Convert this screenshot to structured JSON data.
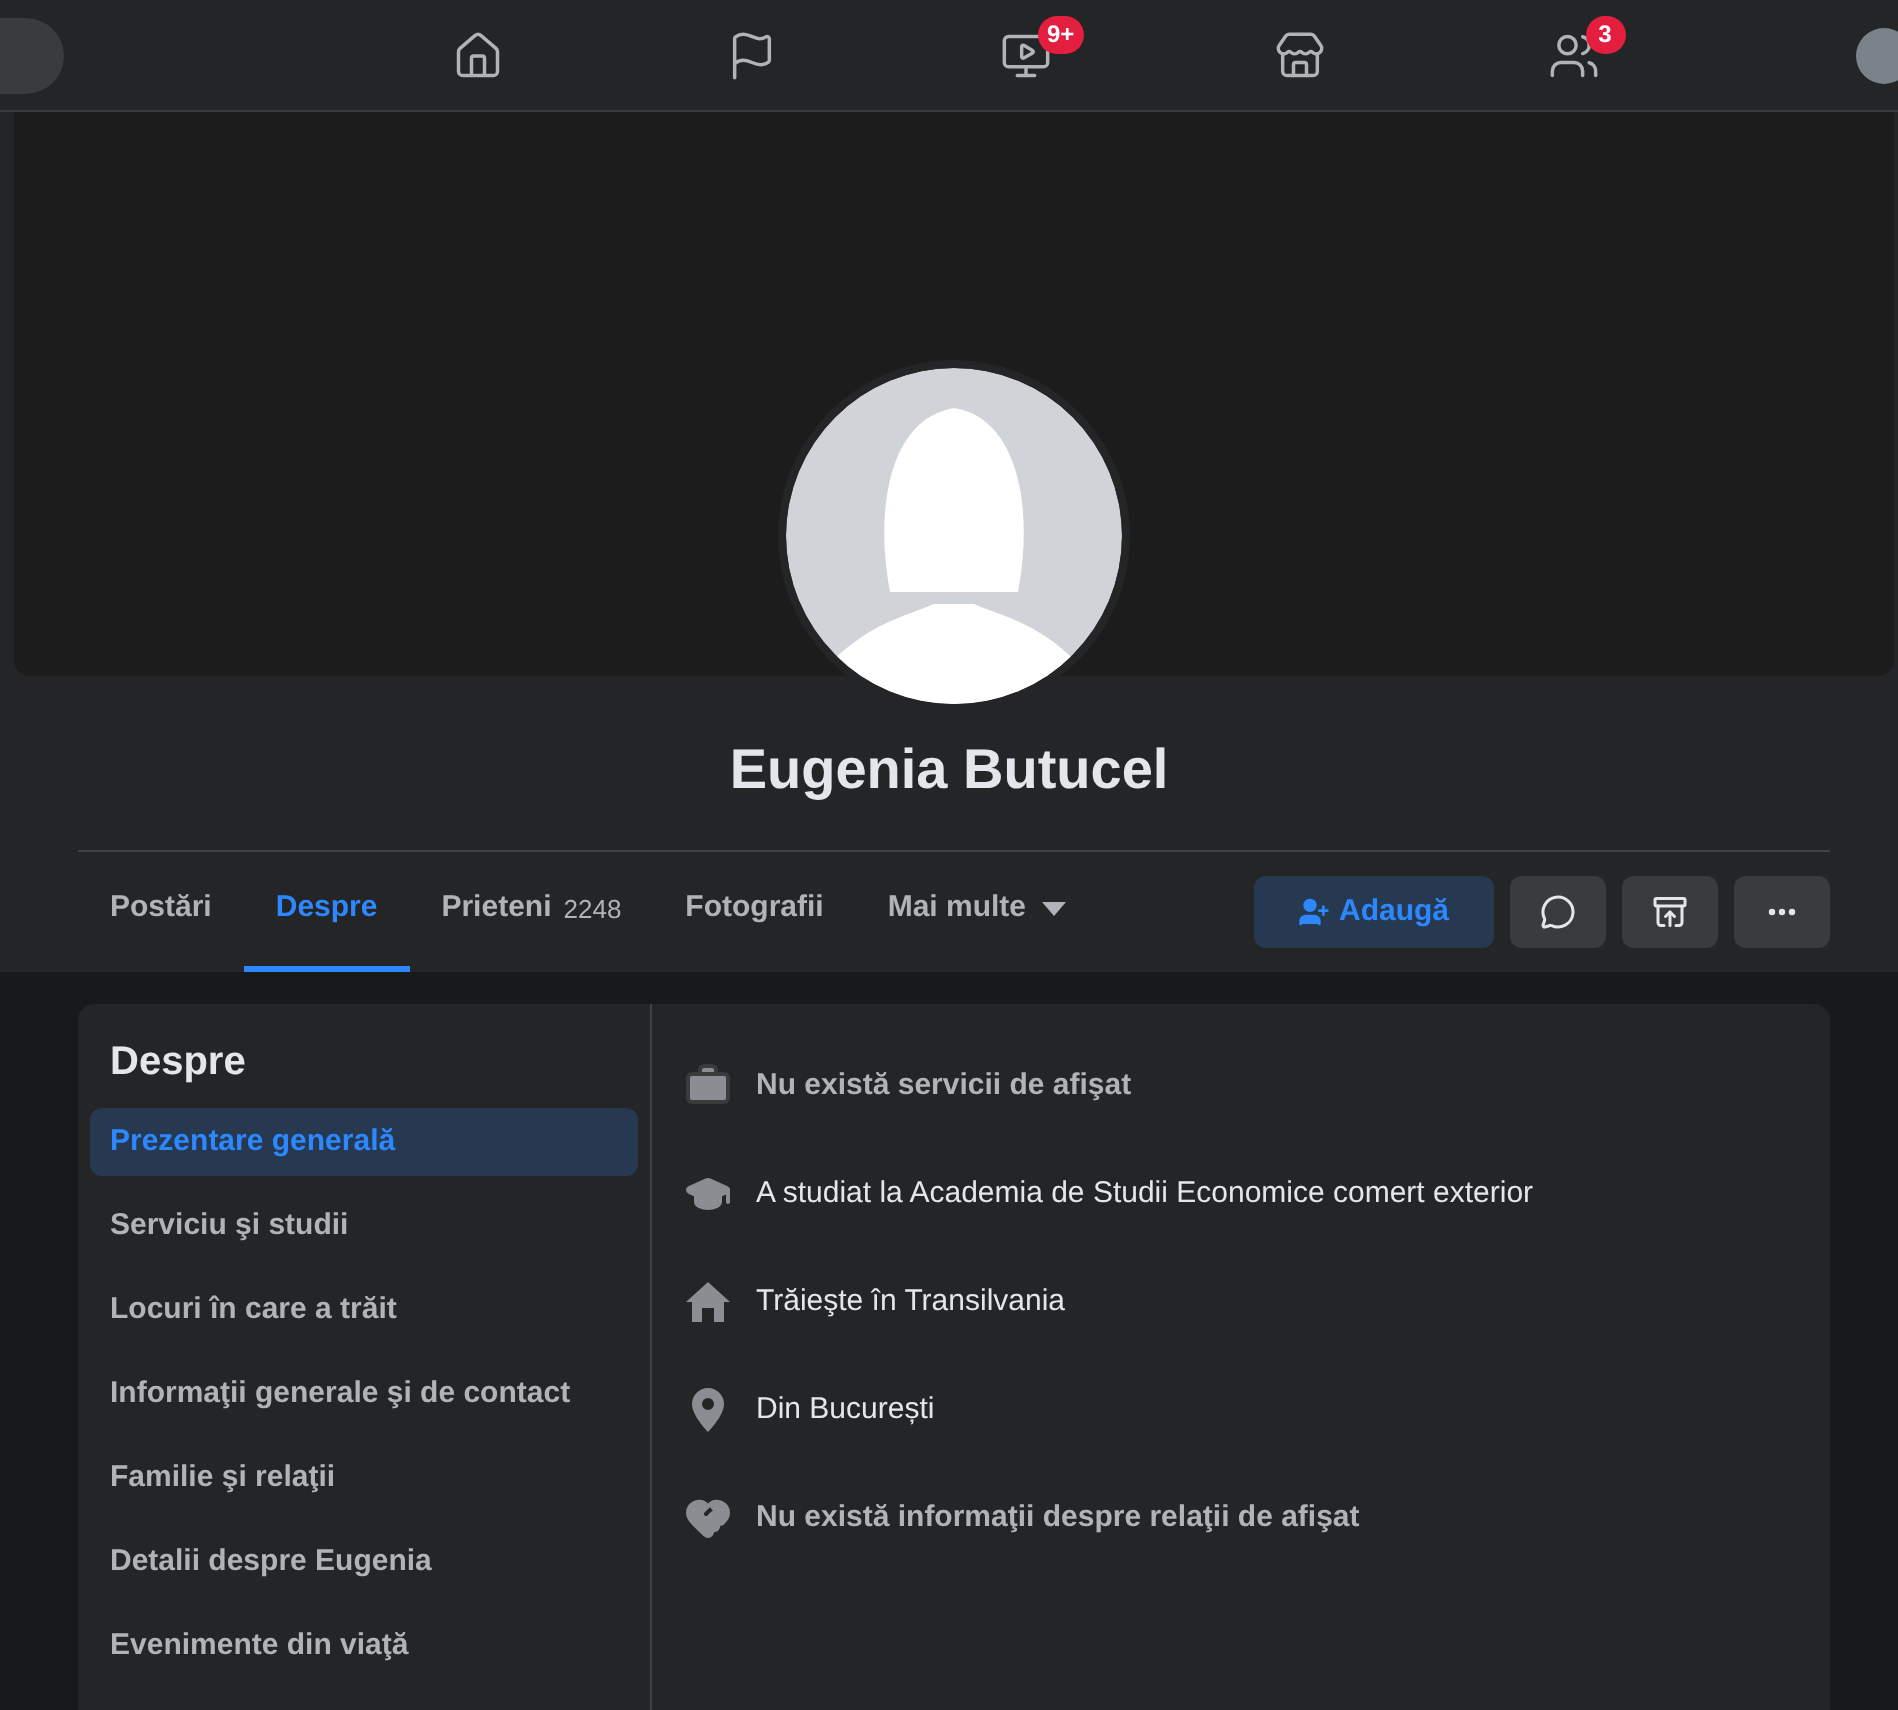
{
  "nav": [
    {
      "selected": false
    },
    {
      "selected": false
    },
    {
      "badge": "9+",
      "selected": false
    },
    {
      "selected": false
    },
    {
      "badge": "3",
      "selected": false
    }
  ],
  "profile": {
    "name": "Eugenia Butucel"
  },
  "tabs": [
    {
      "label": "Postări",
      "selected": false
    },
    {
      "label": "Despre",
      "selected": true
    },
    {
      "label": "Prieteni",
      "count": "2248",
      "selected": false
    },
    {
      "label": "Fotografii",
      "selected": false
    },
    {
      "label": "Mai multe",
      "dropdown": true,
      "selected": false
    }
  ],
  "actions": {
    "add": "Adaugă"
  },
  "about": {
    "title": "Despre",
    "items": [
      {
        "label": "Prezentare generală",
        "selected": true
      },
      {
        "label": "Serviciu şi studii",
        "selected": false
      },
      {
        "label": "Locuri în care a trăit",
        "selected": false
      },
      {
        "label": "Informaţii generale şi de contact",
        "selected": false
      },
      {
        "label": "Familie şi relaţii",
        "selected": false
      },
      {
        "label": "Detalii despre Eugenia",
        "selected": false
      },
      {
        "label": "Evenimente din viaţă",
        "selected": false
      }
    ],
    "details": [
      {
        "text": "Nu există servicii de afişat",
        "empty": true
      },
      {
        "text": "A studiat la Academia de Studii Economice comert exterior",
        "empty": false
      },
      {
        "text": "Trăieşte în Transilvania",
        "empty": false
      },
      {
        "text": "Din București",
        "empty": false
      },
      {
        "text": "Nu există informaţii despre relaţii de afişat",
        "empty": true
      }
    ]
  }
}
